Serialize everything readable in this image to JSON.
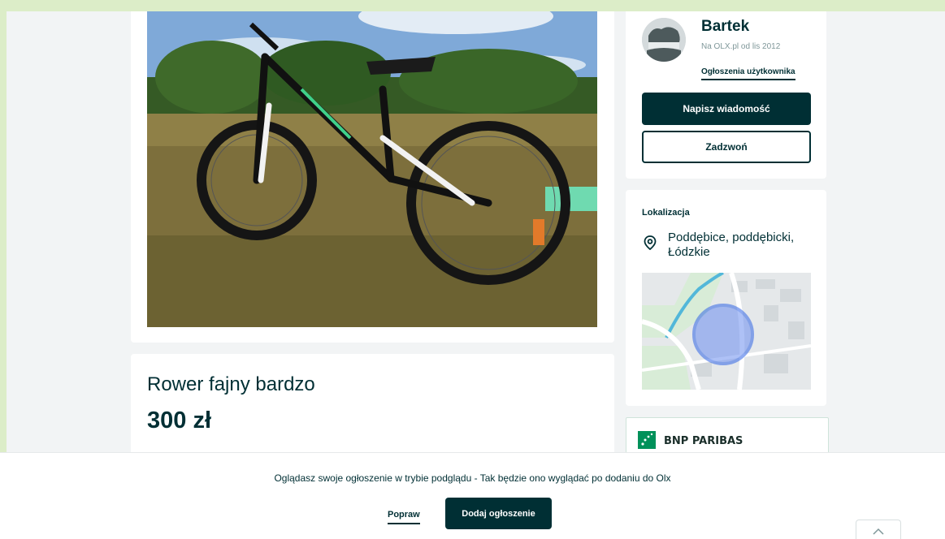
{
  "ad": {
    "title": "Rower fajny bardzo",
    "price": "300 zł",
    "photo_icon": "bicycle-photo"
  },
  "seller": {
    "name": "Bartek",
    "since": "Na OLX.pl od lis 2012",
    "ads_link": "Ogłoszenia użytkownika",
    "message_button": "Napisz wiadomość",
    "call_button": "Zadzwoń"
  },
  "location": {
    "heading": "Lokalizacja",
    "place": "Poddębice, poddębicki, Łódzkie",
    "icon": "map-pin-icon"
  },
  "bank": {
    "name": "BNP PARIBAS"
  },
  "preview": {
    "text": "Oglądasz swoje ogłoszenie w trybie podglądu - Tak będzie ono wyglądać po dodaniu do Olx",
    "edit_label": "Popraw",
    "add_label": "Dodaj ogłoszenie",
    "scroll_top_icon": "chevron-up-icon"
  },
  "colors": {
    "primary": "#002f34",
    "page_bg": "#f2f4f5",
    "frame": "#dcedc8"
  }
}
